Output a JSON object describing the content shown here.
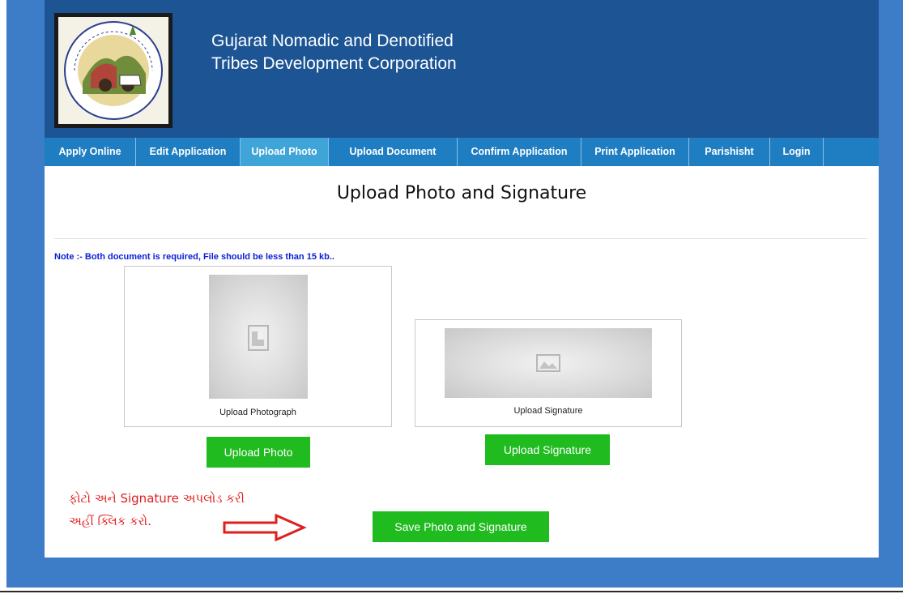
{
  "header": {
    "org_line1": "Gujarat Nomadic and Denotified",
    "org_line2": "Tribes Development Corporation"
  },
  "nav": {
    "items": [
      {
        "label": "Apply Online"
      },
      {
        "label": "Edit Application"
      },
      {
        "label": "Upload Photo",
        "active": true
      },
      {
        "label": "Upload Document"
      },
      {
        "label": "Confirm Application"
      },
      {
        "label": "Print Application"
      },
      {
        "label": "Parishisht"
      },
      {
        "label": "Login"
      }
    ]
  },
  "main": {
    "title": "Upload Photo and Signature",
    "note": "Note :- Both document is required, File should be less than 15 kb..",
    "photo_caption": "Upload Photograph",
    "signature_caption": "Upload Signature",
    "upload_photo_button": "Upload Photo",
    "upload_signature_button": "Upload Signature",
    "save_button": "Save Photo and Signature",
    "instruction_line1": "ફોટો અને Signature અપલોડ કરી",
    "instruction_line2": "અહીં ક્લિક કરો."
  },
  "colors": {
    "page_bg": "#3d7cc6",
    "header_bg": "#1c5494",
    "nav_bg": "#1f7ec2",
    "nav_active_bg": "#3fa5d8",
    "button_green": "#1fbb1f",
    "note_blue": "#0a1fd6",
    "instruction_red": "#e01e1e"
  },
  "icons": [
    "logo-emblem",
    "image-placeholder-icon",
    "arrow-right-icon"
  ]
}
